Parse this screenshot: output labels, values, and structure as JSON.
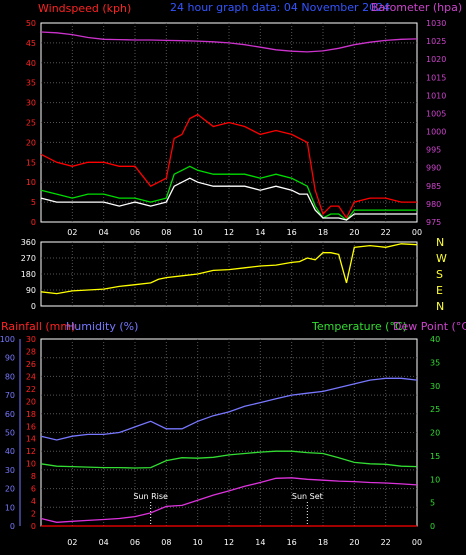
{
  "chart_data": [
    {
      "type": "line",
      "title": "24 hour graph data: 04 November 2024",
      "left_label": "Windspeed (kph)",
      "right_label": "Barometer (hpa)",
      "left_ylim": [
        0,
        50
      ],
      "left_ticks": [
        0,
        5,
        10,
        15,
        20,
        25,
        30,
        35,
        40,
        45,
        50
      ],
      "right_ylim": [
        975,
        1030
      ],
      "right_ticks": [
        975,
        980,
        985,
        990,
        995,
        1000,
        1005,
        1010,
        1015,
        1020,
        1025,
        1030
      ],
      "x_hours": [
        0,
        24
      ],
      "x_ticks": [
        "02",
        "04",
        "06",
        "08",
        "10",
        "12",
        "14",
        "16",
        "18",
        "20",
        "22",
        "00"
      ],
      "grid": true,
      "series": [
        {
          "color": "#ff0000",
          "axis": "left",
          "x": [
            0,
            1,
            2,
            3,
            4,
            5,
            6,
            7,
            8,
            8.5,
            9,
            9.5,
            10,
            11,
            12,
            13,
            14,
            15,
            16,
            16.5,
            17,
            17.5,
            18,
            18.5,
            19,
            19.5,
            20,
            21,
            22,
            23,
            24
          ],
          "y": [
            17,
            15,
            14,
            15,
            15,
            14,
            14,
            9,
            11,
            21,
            22,
            26,
            27,
            24,
            25,
            24,
            22,
            23,
            22,
            21,
            20,
            8,
            2,
            4,
            4,
            1,
            5,
            6,
            6,
            5,
            5
          ]
        },
        {
          "color": "#00dd00",
          "axis": "left",
          "x": [
            0,
            1,
            2,
            3,
            4,
            5,
            6,
            7,
            8,
            8.5,
            9,
            9.5,
            10,
            11,
            12,
            13,
            14,
            15,
            16,
            16.5,
            17,
            17.5,
            18,
            18.5,
            19,
            19.5,
            20,
            21,
            22,
            23,
            24
          ],
          "y": [
            8,
            7,
            6,
            7,
            7,
            6,
            6,
            5,
            6,
            12,
            13,
            14,
            13,
            12,
            12,
            12,
            11,
            12,
            11,
            10,
            9,
            4,
            1,
            2,
            2,
            0.5,
            3,
            3,
            3,
            3,
            3
          ]
        },
        {
          "color": "#ffffff",
          "axis": "left",
          "x": [
            0,
            1,
            2,
            3,
            4,
            5,
            6,
            7,
            8,
            8.5,
            9,
            9.5,
            10,
            11,
            12,
            13,
            14,
            15,
            16,
            16.5,
            17,
            17.5,
            18,
            18.5,
            19,
            19.5,
            20,
            21,
            22,
            23,
            24
          ],
          "y": [
            6,
            5,
            5,
            5,
            5,
            4,
            5,
            4,
            5,
            9,
            10,
            11,
            10,
            9,
            9,
            9,
            8,
            9,
            8,
            7,
            7,
            3,
            1,
            1,
            1,
            0.5,
            2,
            2,
            2,
            2,
            2
          ]
        },
        {
          "color": "#cc33cc",
          "axis": "right",
          "x": [
            0,
            1,
            2,
            3,
            4,
            5,
            6,
            7,
            8,
            9,
            10,
            11,
            12,
            13,
            14,
            15,
            16,
            17,
            18,
            19,
            20,
            21,
            22,
            23,
            24
          ],
          "y": [
            1027.5,
            1027.3,
            1026.8,
            1026,
            1025.5,
            1025.4,
            1025.3,
            1025.3,
            1025.2,
            1025.1,
            1025,
            1024.8,
            1024.5,
            1024,
            1023.3,
            1022.6,
            1022.2,
            1022,
            1022.3,
            1023,
            1024,
            1024.7,
            1025.2,
            1025.5,
            1025.6
          ]
        }
      ]
    },
    {
      "type": "line",
      "ylim": [
        0,
        360
      ],
      "left_ticks": [
        0,
        90,
        180,
        270,
        360
      ],
      "right_labels": [
        "N",
        "W",
        "S",
        "E",
        "N"
      ],
      "x_hours": [
        0,
        24
      ],
      "grid": true,
      "series": [
        {
          "color": "#ffff00",
          "x": [
            0,
            1,
            2,
            3,
            4,
            5,
            6,
            7,
            7.5,
            8,
            9,
            10,
            11,
            12,
            13,
            14,
            15,
            16,
            16.5,
            17,
            17.5,
            18,
            18.5,
            19,
            19.5,
            20,
            21,
            22,
            23,
            24
          ],
          "y": [
            80,
            70,
            85,
            90,
            95,
            110,
            120,
            130,
            150,
            160,
            170,
            180,
            200,
            205,
            215,
            225,
            230,
            245,
            250,
            270,
            260,
            300,
            300,
            290,
            130,
            330,
            340,
            330,
            350,
            345
          ]
        }
      ]
    },
    {
      "type": "line",
      "left_label_1": "Rainfall (mm)",
      "left_label_2": "Humidity (%)",
      "right_label_1": "Temperature (°C)",
      "right_label_2": "Dew Point (°C)",
      "rain_ylim": [
        0,
        30
      ],
      "rain_ticks": [
        0,
        2,
        4,
        6,
        8,
        10,
        12,
        14,
        16,
        18,
        20,
        22,
        24,
        26,
        28,
        30
      ],
      "humidity_ylim": [
        0,
        100
      ],
      "humidity_ticks": [
        0,
        10,
        20,
        30,
        40,
        50,
        60,
        70,
        80,
        90,
        100
      ],
      "temp_ylim": [
        0,
        40
      ],
      "temp_ticks": [
        0,
        5,
        10,
        15,
        20,
        25,
        30,
        35,
        40
      ],
      "x_hours": [
        0,
        24
      ],
      "x_ticks": [
        "02",
        "04",
        "06",
        "08",
        "10",
        "12",
        "14",
        "16",
        "18",
        "20",
        "22",
        "00"
      ],
      "grid": true,
      "annotations": [
        {
          "text": "Sun Rise",
          "hour": 7
        },
        {
          "text": "Sun Set",
          "hour": 17
        }
      ],
      "series": [
        {
          "color": "#7777ff",
          "axis": "humidity",
          "x": [
            0,
            1,
            2,
            3,
            4,
            5,
            6,
            7,
            8,
            9,
            10,
            11,
            12,
            13,
            14,
            15,
            16,
            17,
            18,
            19,
            20,
            21,
            22,
            23,
            24
          ],
          "y": [
            48,
            46,
            48,
            49,
            49,
            50,
            53,
            56,
            52,
            52,
            56,
            59,
            61,
            64,
            66,
            68,
            70,
            71,
            72,
            74,
            76,
            78,
            79,
            79,
            78
          ]
        },
        {
          "color": "#33dd33",
          "axis": "temp",
          "x": [
            0,
            1,
            2,
            3,
            4,
            5,
            6,
            7,
            8,
            9,
            10,
            11,
            12,
            13,
            14,
            15,
            16,
            17,
            18,
            19,
            20,
            21,
            22,
            23,
            24
          ],
          "y": [
            13.3,
            12.8,
            12.7,
            12.6,
            12.5,
            12.5,
            12.4,
            12.5,
            14,
            14.6,
            14.5,
            14.7,
            15.2,
            15.5,
            15.8,
            16,
            16,
            15.7,
            15.5,
            14.6,
            13.6,
            13.3,
            13.2,
            12.8,
            12.7
          ]
        },
        {
          "color": "#dd33dd",
          "axis": "temp",
          "x": [
            0,
            1,
            2,
            3,
            4,
            5,
            6,
            7,
            8,
            9,
            10,
            11,
            12,
            13,
            14,
            15,
            16,
            17,
            18,
            19,
            20,
            21,
            22,
            23,
            24
          ],
          "y": [
            1.6,
            0.8,
            1.0,
            1.2,
            1.4,
            1.6,
            2.0,
            2.8,
            4.2,
            4.4,
            5.5,
            6.6,
            7.5,
            8.5,
            9.3,
            10.2,
            10.3,
            10.0,
            9.8,
            9.6,
            9.5,
            9.3,
            9.2,
            9.0,
            8.8
          ]
        },
        {
          "color": "#ff0000",
          "axis": "rain",
          "x": [
            0,
            24
          ],
          "y": [
            0,
            0
          ]
        }
      ]
    }
  ]
}
